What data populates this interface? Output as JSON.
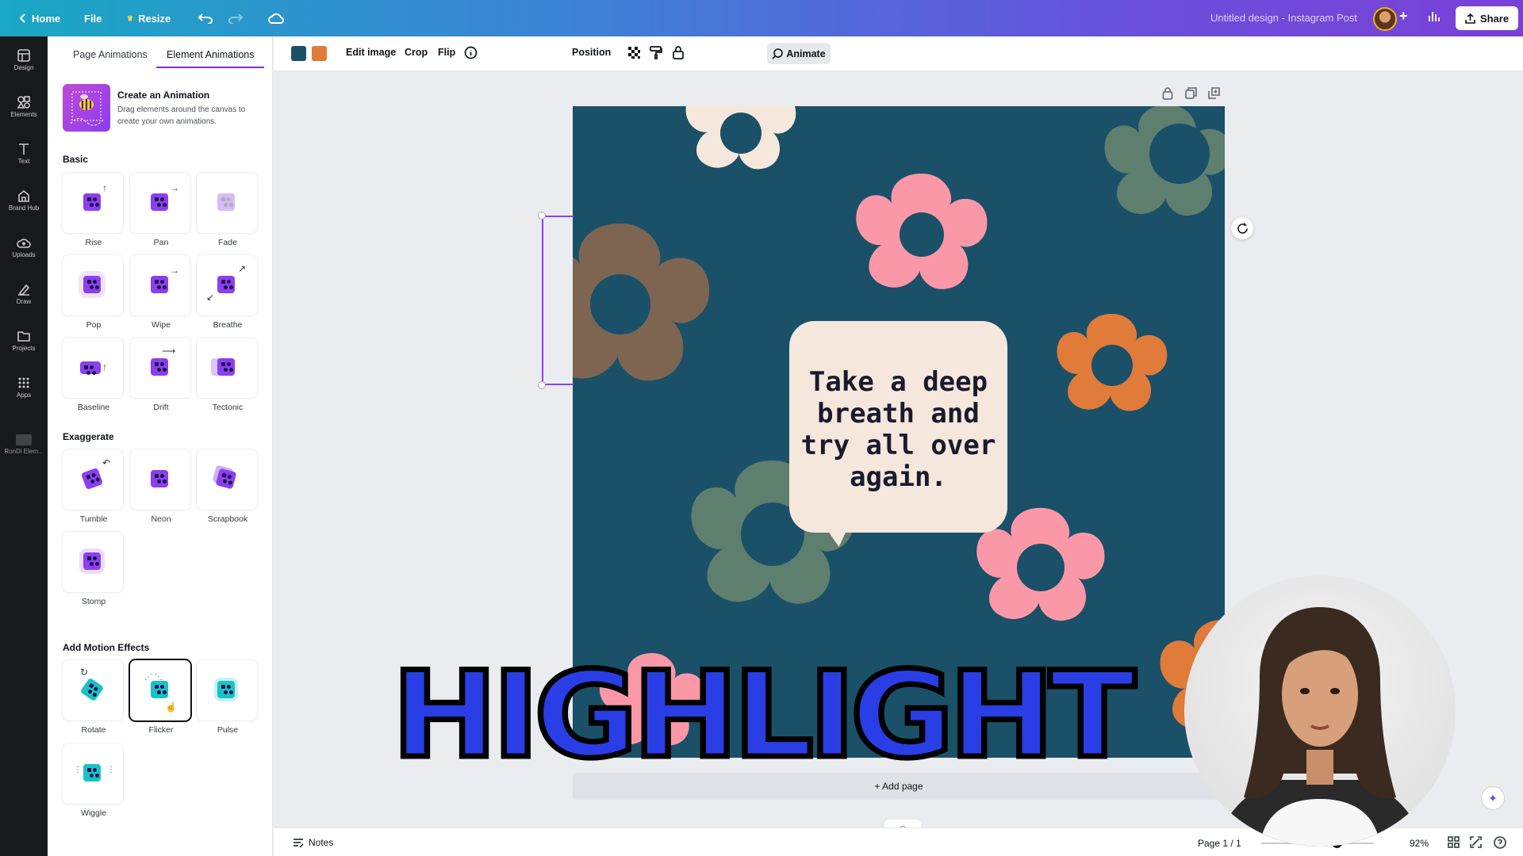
{
  "topbar": {
    "home_label": "Home",
    "file_label": "File",
    "resize_label": "Resize",
    "design_title": "Untitled design - Instagram Post",
    "share_label": "Share"
  },
  "rail": {
    "items": [
      {
        "label": "Design",
        "icon": "layout-icon"
      },
      {
        "label": "Elements",
        "icon": "shapes-icon"
      },
      {
        "label": "Text",
        "icon": "text-icon"
      },
      {
        "label": "Brand Hub",
        "icon": "brand-icon"
      },
      {
        "label": "Uploads",
        "icon": "cloud-upload-icon"
      },
      {
        "label": "Draw",
        "icon": "pen-icon"
      },
      {
        "label": "Projects",
        "icon": "folder-icon"
      },
      {
        "label": "Apps",
        "icon": "grid-icon"
      },
      {
        "label": "RonDi Elem...",
        "icon": "app-icon"
      }
    ]
  },
  "panel": {
    "tabs": [
      "Page Animations",
      "Element Animations"
    ],
    "active_tab": "Element Animations",
    "create": {
      "title": "Create an Animation",
      "desc": "Drag elements around the canvas to create your own animations."
    },
    "sections": {
      "basic": "Basic",
      "exaggerate": "Exaggerate",
      "motion": "Add Motion Effects"
    },
    "basic": [
      "Rise",
      "Pan",
      "Fade",
      "Pop",
      "Wipe",
      "Breathe",
      "Baseline",
      "Drift",
      "Tectonic"
    ],
    "exaggerate": [
      "Tumble",
      "Neon",
      "Scrapbook",
      "Stomp"
    ],
    "motion": [
      "Rotate",
      "Flicker",
      "Pulse",
      "Wiggle"
    ],
    "selected": "Flicker"
  },
  "ctxbar": {
    "swatches": [
      "#1a5068",
      "#e07b3a"
    ],
    "edit_image": "Edit image",
    "crop": "Crop",
    "flip": "Flip",
    "animate": "Animate",
    "position": "Position"
  },
  "canvas": {
    "background": "#1a5068",
    "speech_text": "Take a deep breath and try all over again.",
    "flower_colors": {
      "pink": "#fb98a8",
      "cream": "#f5e7dc",
      "orange": "#e07b3a",
      "brown": "#7d6552",
      "sage": "#5e7e6e"
    }
  },
  "overlay": {
    "highlight_text": "HIGHLIGHT",
    "highlight_color": "#2a3ee6"
  },
  "add_page_label": "+ Add page",
  "bottombar": {
    "notes_label": "Notes",
    "page_indicator": "Page 1 / 1",
    "zoom_label": "92%",
    "zoom_value": 0.92
  },
  "colors": {
    "accent": "#7d2ae8",
    "anim_icon": "#8d3ef0",
    "motion_icon": "#16c3c7"
  }
}
